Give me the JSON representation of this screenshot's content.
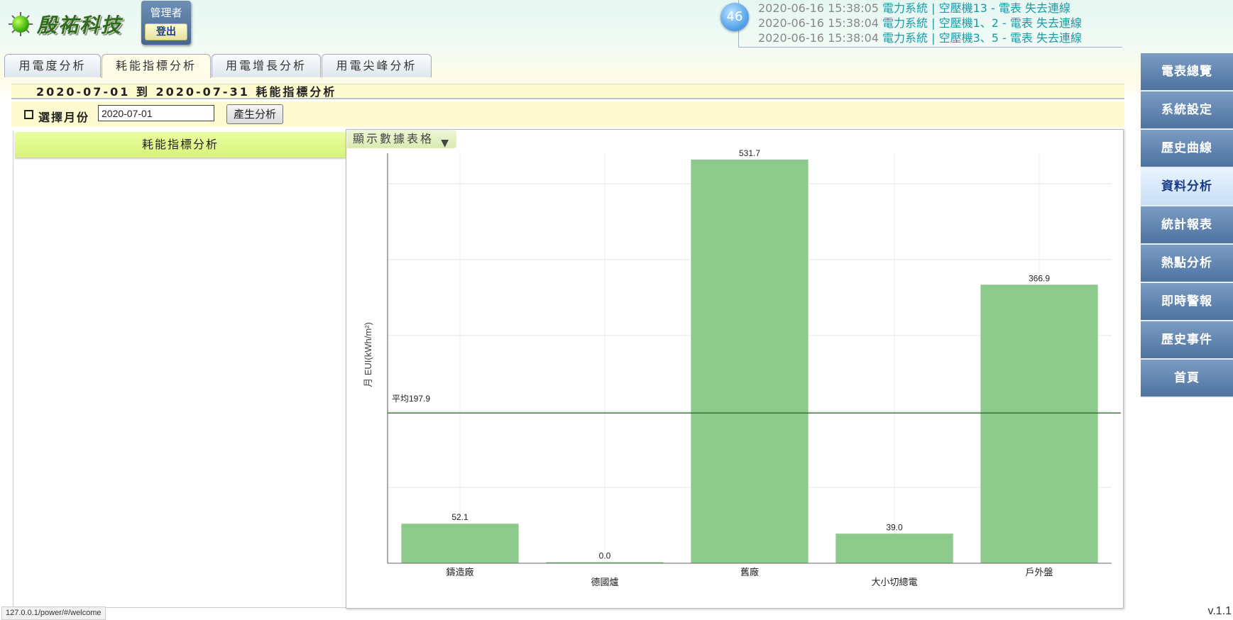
{
  "header": {
    "logo_text": "殷祐科技",
    "user": "管理者",
    "logout": "登出",
    "notification_count": "46",
    "notifications": [
      {
        "time": "2020-06-16 15:38:05",
        "message": "電力系統 | 空壓機13 - 電表 失去連線"
      },
      {
        "time": "2020-06-16 15:38:04",
        "message": "電力系統 | 空壓機1、2 - 電表 失去連線"
      },
      {
        "time": "2020-06-16 15:38:04",
        "message": "電力系統 | 空壓機3、5 - 電表 失去連線"
      }
    ]
  },
  "tabs": [
    {
      "label": "用電度分析",
      "active": false
    },
    {
      "label": "耗能指標分析",
      "active": true
    },
    {
      "label": "用電增長分析",
      "active": false
    },
    {
      "label": "用電尖峰分析",
      "active": false
    }
  ],
  "main": {
    "title": "2020-07-01 到 2020-07-31 耗能指標分析",
    "month_label": "選擇月份",
    "month_value": "2020-07-01",
    "generate_button": "產生分析",
    "left_panel_title": "耗能指標分析",
    "table_toggle": "顯示數據表格"
  },
  "sidebar": {
    "items": [
      {
        "label": "電表總覽",
        "active": false
      },
      {
        "label": "系統設定",
        "active": false
      },
      {
        "label": "歷史曲線",
        "active": false
      },
      {
        "label": "資料分析",
        "active": true
      },
      {
        "label": "統計報表",
        "active": false
      },
      {
        "label": "熱點分析",
        "active": false
      },
      {
        "label": "即時警報",
        "active": false
      },
      {
        "label": "歷史事件",
        "active": false
      },
      {
        "label": "首頁",
        "active": false
      }
    ]
  },
  "status_url": "127.0.0.1/power/#/welcome",
  "version": "v.1.1",
  "colors": {
    "bar": "#8dc98a",
    "average_line": "#2f6e2f",
    "nav": "#5b7fae",
    "accent_yellow": "#fffbd0"
  },
  "chart_data": {
    "type": "bar",
    "categories": [
      "鑄造廠",
      "德國爐",
      "舊廠",
      "大小切總電",
      "戶外盤"
    ],
    "values": [
      52.1,
      0.0,
      531.7,
      39.0,
      366.9
    ],
    "data_labels": [
      "52.1",
      "0.0",
      "531.7",
      "39.0",
      "366.9"
    ],
    "ylabel": "月 EUI(kWh/m²)",
    "ylim": [
      0,
      540
    ],
    "grid_step": 100,
    "average": 197.9,
    "average_label": "平均197.9",
    "grid": true
  }
}
